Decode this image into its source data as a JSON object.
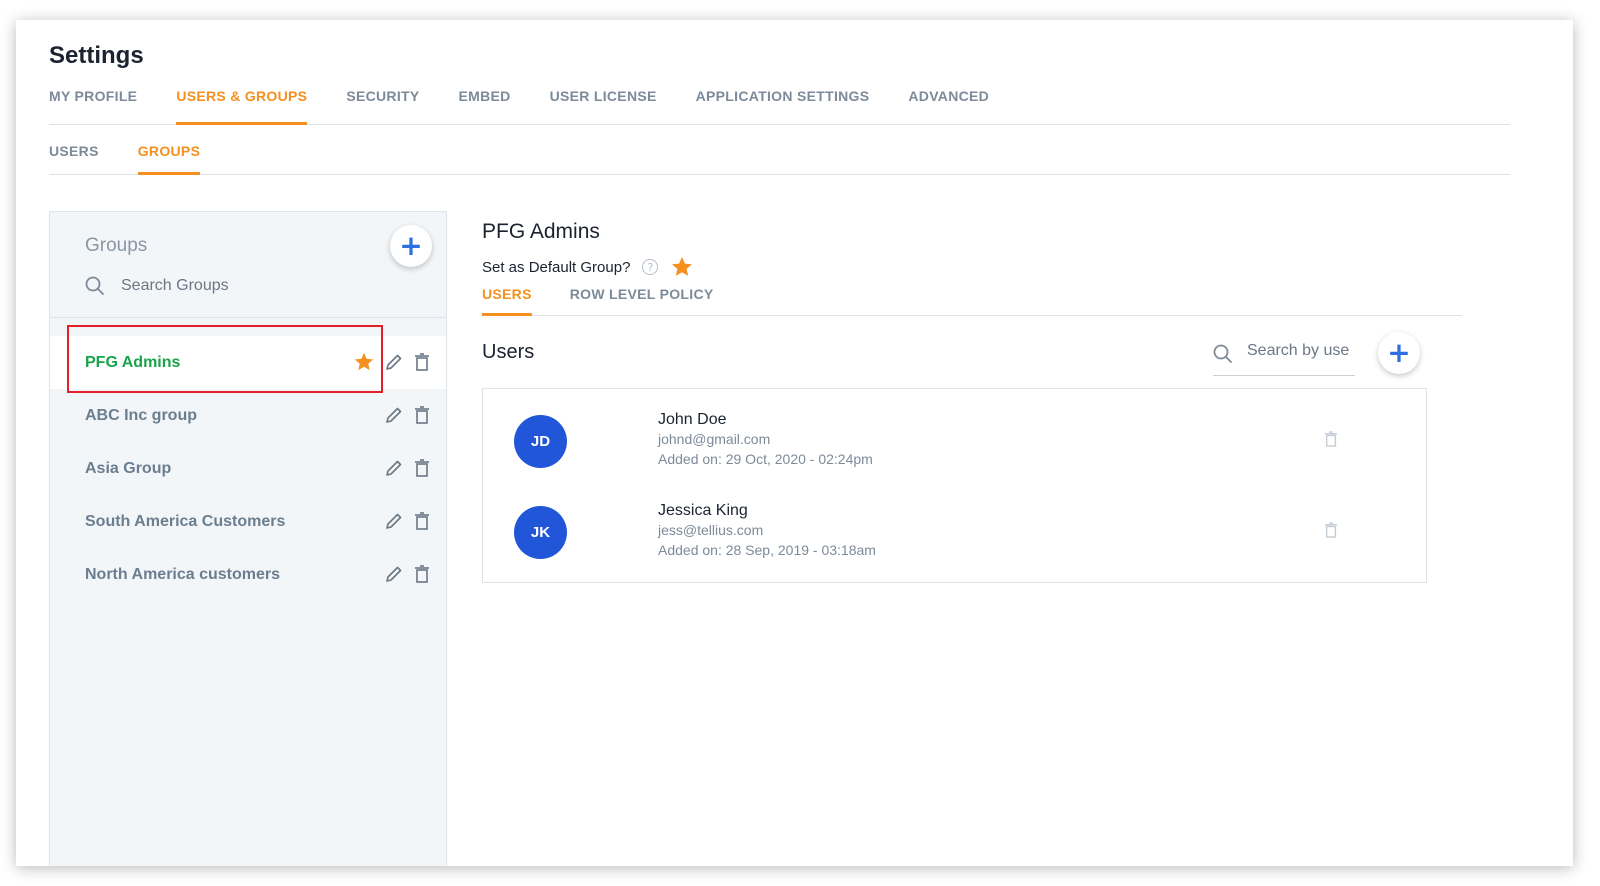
{
  "page": {
    "title": "Settings"
  },
  "main_tabs": [
    {
      "label": "MY PROFILE",
      "active": false
    },
    {
      "label": "USERS & GROUPS",
      "active": true
    },
    {
      "label": "SECURITY",
      "active": false
    },
    {
      "label": "EMBED",
      "active": false
    },
    {
      "label": "USER LICENSE",
      "active": false
    },
    {
      "label": "APPLICATION SETTINGS",
      "active": false
    },
    {
      "label": "ADVANCED",
      "active": false
    }
  ],
  "sub_tabs": [
    {
      "label": "USERS",
      "active": false
    },
    {
      "label": "GROUPS",
      "active": true
    }
  ],
  "groups_panel": {
    "heading": "Groups",
    "add_label": "+",
    "search_placeholder": "Search Groups",
    "items": [
      {
        "name": "PFG Admins",
        "selected": true,
        "default": true
      },
      {
        "name": "ABC Inc group",
        "selected": false,
        "default": false
      },
      {
        "name": "Asia Group",
        "selected": false,
        "default": false
      },
      {
        "name": "South America Customers",
        "selected": false,
        "default": false
      },
      {
        "name": "North America customers",
        "selected": false,
        "default": false
      }
    ]
  },
  "detail": {
    "title": "PFG Admins",
    "default_label": "Set as Default Group?",
    "help_icon_glyph": "?",
    "tabs": [
      {
        "label": "USERS",
        "active": true
      },
      {
        "label": "ROW LEVEL POLICY",
        "active": false
      }
    ],
    "users_heading": "Users",
    "search_placeholder": "Search by use",
    "add_label": "+",
    "users": [
      {
        "initials": "JD",
        "name": "John Doe",
        "email": "johnd@gmail.com",
        "added": "Added on: 29 Oct, 2020 - 02:24pm"
      },
      {
        "initials": "JK",
        "name": "Jessica King",
        "email": "jess@tellius.com",
        "added": "Added on: 28 Sep, 2019 - 03:18am"
      }
    ]
  },
  "colors": {
    "accent": "#f5901e",
    "selected_group": "#1aa34a",
    "avatar": "#2156d9",
    "add_icon": "#2f6fe0",
    "highlight": "#e3202a"
  },
  "icons": {
    "star": "star-icon",
    "edit": "pencil-icon",
    "delete": "trash-icon",
    "search": "search-icon",
    "help": "question-icon",
    "add": "plus-icon"
  }
}
